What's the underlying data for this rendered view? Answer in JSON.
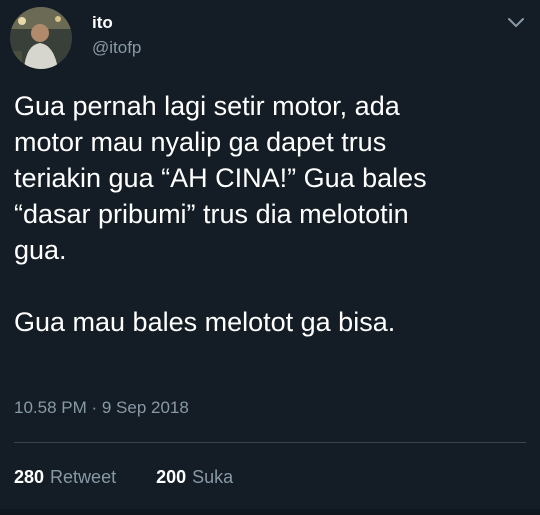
{
  "user": {
    "display_name": "ito",
    "handle": "@itofp"
  },
  "tweet": {
    "text": "Gua pernah lagi setir motor, ada\nmotor mau nyalip ga dapet trus\nteriakin gua “AH CINA!” Gua bales\n“dasar pribumi” trus dia melototin\ngua.\n\nGua mau bales melotot ga bisa.",
    "timestamp": "10.58 PM · 9 Sep 2018"
  },
  "stats": {
    "retweet_count": "280",
    "retweet_label": "Retweet",
    "like_count": "200",
    "like_label": "Suka"
  },
  "icons": {
    "menu": "chevron-down-icon"
  },
  "colors": {
    "background": "#141d26",
    "secondary_text": "#8899a6",
    "divider": "#38444d"
  }
}
